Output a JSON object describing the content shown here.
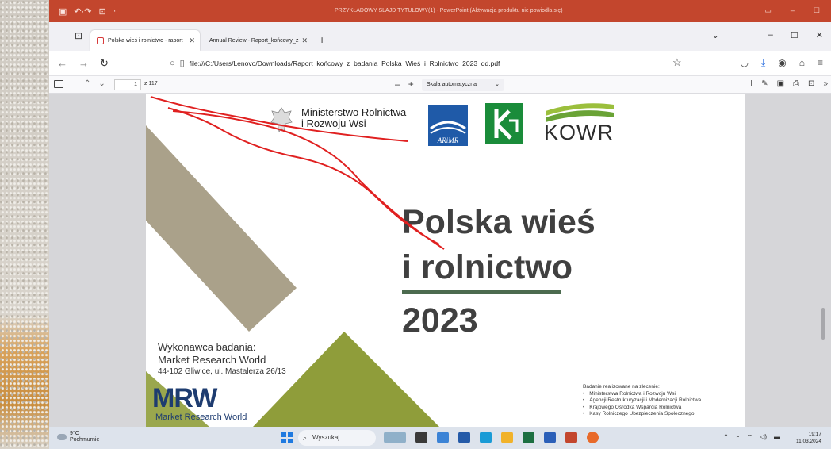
{
  "powerpoint": {
    "window_title": "PRZYKŁADOWY SLAJD TYTUŁOWY(1) - PowerPoint (Aktywacja produktu nie powiodła się)",
    "accent": "#c3462d"
  },
  "browser": {
    "tabs": [
      {
        "label": "Polska wieś i rolnictwo - raport",
        "active": true
      },
      {
        "label": "Annual Review - Raport_końcowy_z",
        "active": false
      }
    ],
    "url": "file:///C:/Users/Lenovo/Downloads/Raport_końcowy_z_badania_Polska_Wieś_i_Rolnictwo_2023_dd.pdf"
  },
  "pdf_toolbar": {
    "page_current": "1",
    "page_total": "z 117",
    "zoom": "Skala automatyczna"
  },
  "document": {
    "ministry_line1": "Ministerstwo Rolnictwa",
    "ministry_line2": "i Rozwoju Wsi",
    "arimr_label": "ARiMR",
    "kowr_label": "KOWR",
    "title_line1": "Polska wieś",
    "title_line2": "i rolnictwo",
    "title_year": "2023",
    "contractor_label": "Wykonawca badania:",
    "contractor_name": "Market Research World",
    "contractor_address": "44-102 Gliwice, ul. Mastalerza 26/13",
    "mrw_logo": "MRW",
    "mrw_logo_sub": "Market Research World",
    "commission_heading": "Badanie realizowane na zlecenie:",
    "commission_items": [
      "Ministerstwa Rolnictwa i Rozwoju Wsi",
      "Agencji Restrukturyzacji i Modernizacji Rolnictwa",
      "Krajowego Ośrodka Wsparcia Rolnictwa",
      "Kasy Rolniczego Ubezpieczenia Społecznego"
    ],
    "annotation_color": "#e02020"
  },
  "taskbar": {
    "weather_temp": "9°C",
    "weather_desc": "Pochmurnie",
    "search_placeholder": "Wyszukaj",
    "time": "19:17",
    "date": "11.03.2024"
  }
}
